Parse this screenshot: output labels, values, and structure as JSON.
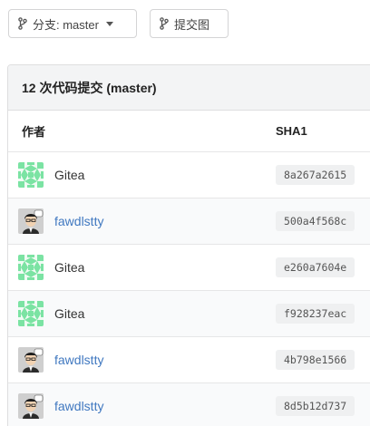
{
  "toolbar": {
    "branch_label": "分支: master",
    "graph_label": "提交图"
  },
  "panel": {
    "title": "12 次代码提交 (master)",
    "col_author": "作者",
    "col_sha": "SHA1"
  },
  "commits": [
    {
      "author": "Gitea",
      "sha": "8a267a2615",
      "avatar": "identicon"
    },
    {
      "author": "fawdlstty",
      "sha": "500a4f568c",
      "avatar": "photo"
    },
    {
      "author": "Gitea",
      "sha": "e260a7604e",
      "avatar": "identicon"
    },
    {
      "author": "Gitea",
      "sha": "f928237eac",
      "avatar": "identicon"
    },
    {
      "author": "fawdlstty",
      "sha": "4b798e1566",
      "avatar": "photo"
    },
    {
      "author": "fawdlstty",
      "sha": "8d5b12d737",
      "avatar": "photo"
    }
  ],
  "colors": {
    "link": "#4078c0",
    "identicon": "#7be3a3"
  }
}
